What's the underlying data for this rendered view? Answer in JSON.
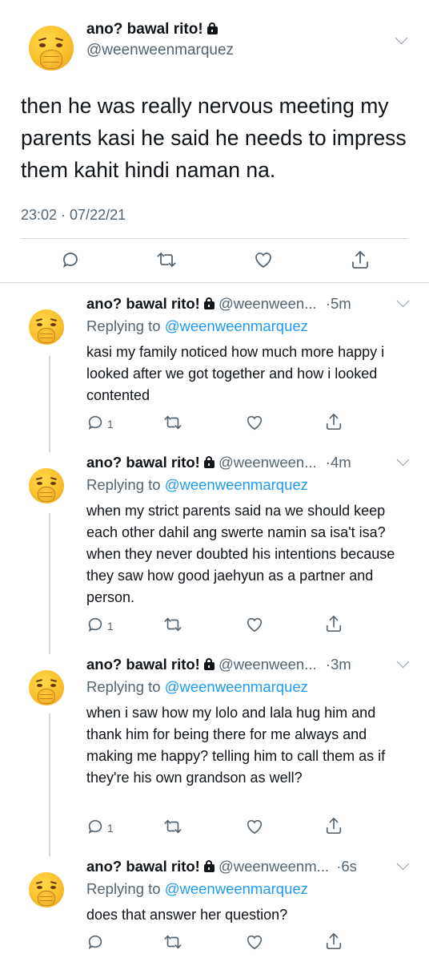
{
  "main": {
    "author_name": "ano? bawal rito!",
    "author_handle": "@weenweenmarquez",
    "text": "then he was really nervous meeting my parents kasi he said he needs to impress them kahit hindi naman na.",
    "timestamp": "23:02 · 07/22/21",
    "icons": [
      "reply-icon",
      "retweet-icon",
      "like-icon",
      "share-icon"
    ]
  },
  "replies": [
    {
      "name": "ano? bawal rito!",
      "handle": "@weenween...",
      "time": "·5m",
      "replying_label": "Replying to",
      "replying_to": "@weenweenmarquez",
      "text": "kasi my family noticed how much more happy i looked after we got together and how i looked contented",
      "reply_count": "1"
    },
    {
      "name": "ano? bawal rito!",
      "handle": "@weenween...",
      "time": "·4m",
      "replying_label": "Replying to",
      "replying_to": "@weenweenmarquez",
      "text": "when my strict parents said na we should keep each other dahil ang swerte namin sa isa't isa? when they never doubted his intentions because they saw how good jaehyun as a partner and person.",
      "reply_count": "1"
    },
    {
      "name": "ano? bawal rito!",
      "handle": "@weenween...",
      "time": "·3m",
      "replying_label": "Replying to",
      "replying_to": "@weenweenmarquez",
      "text": "when i saw how my lolo and lala hug him and thank him for being there for me always and making me happy? telling him to call them as if they're his own grandson as well?",
      "reply_count": "1"
    },
    {
      "name": "ano? bawal rito!",
      "handle": "@weenweenm...",
      "time": "·6s",
      "replying_label": "Replying to",
      "replying_to": "@weenweenmarquez",
      "text": "does that answer her question?",
      "reply_count": ""
    }
  ],
  "colors": {
    "text": "#0f1419",
    "secondary": "#536471",
    "link": "#1d9bf0",
    "divider": "#cfd9de"
  }
}
